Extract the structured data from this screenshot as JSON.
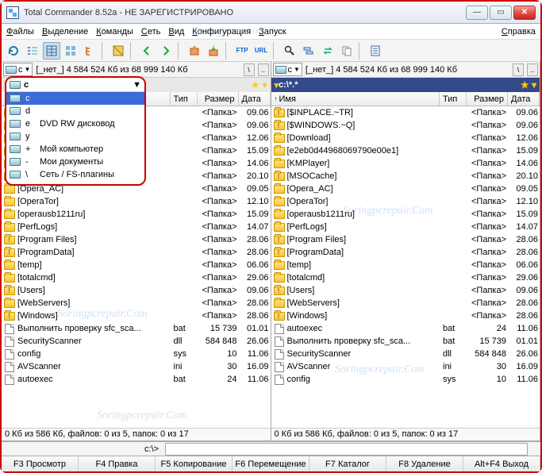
{
  "title": "Total Commander 8.52a - НЕ ЗАРЕГИСТРИРОВАНО",
  "menu": [
    "Файлы",
    "Выделение",
    "Команды",
    "Сеть",
    "Вид",
    "Конфигурация",
    "Запуск"
  ],
  "menu_right": "Справка",
  "drivebar_left": "[_нет_]  4 584 524 Кб из 68 999 140 Кб",
  "drivebar_right": "[_нет_]  4 584 524 Кб из 68 999 140 Кб",
  "drive_letter": "c",
  "path_left": "",
  "path_right": "c:\\*.*",
  "cols": {
    "name": "Имя",
    "ext": "Тип",
    "ext2": "Тип",
    "size": "Размер",
    "date": "Дата"
  },
  "status": "0 Кб из 586 Кб, файлов: 0 из 5, папок: 0 из 17",
  "cmdprompt": "c:\\>",
  "fkeys": [
    "F3 Просмотр",
    "F4 Правка",
    "F5 Копирование",
    "F6 Перемещение",
    "F7 Каталог",
    "F8 Удаление",
    "Alt+F4 Выход"
  ],
  "drive_options": [
    {
      "l": "c",
      "d": "",
      "sel": true,
      "ico": "hdd"
    },
    {
      "l": "d",
      "d": "",
      "ico": "hdd"
    },
    {
      "l": "e",
      "d": "DVD RW дисковод",
      "ico": "cd"
    },
    {
      "l": "y",
      "d": "",
      "ico": "hdd"
    },
    {
      "l": "+",
      "d": "Мой компьютер",
      "ico": "pc"
    },
    {
      "l": "-",
      "d": "Мои документы",
      "ico": "doc"
    },
    {
      "l": "\\",
      "d": "Сеть / FS-плагины",
      "ico": "net"
    }
  ],
  "left_files": [
    {
      "n": "",
      "t": "",
      "s": "<Папка>",
      "d": "09.06",
      "ico": "fld"
    },
    {
      "n": "",
      "t": "",
      "s": "<Папка>",
      "d": "09.06",
      "ico": "fld"
    },
    {
      "n": "",
      "t": "",
      "s": "<Папка>",
      "d": "12.06",
      "ico": "fld"
    },
    {
      "n": "",
      "t": "",
      "s": "<Папка>",
      "d": "15.09",
      "ico": "fld"
    },
    {
      "n": "",
      "t": "",
      "s": "<Папка>",
      "d": "14.06",
      "ico": "fld"
    },
    {
      "n": "",
      "t": "",
      "s": "<Папка>",
      "d": "20.10",
      "ico": "fld"
    },
    {
      "n": "[Opera_AC]",
      "t": "",
      "s": "<Папка>",
      "d": "09.05",
      "ico": "fld"
    },
    {
      "n": "[OperaTor]",
      "t": "",
      "s": "<Папка>",
      "d": "12.10",
      "ico": "fld"
    },
    {
      "n": "[operausb1211ru]",
      "t": "",
      "s": "<Папка>",
      "d": "15.09",
      "ico": "fld"
    },
    {
      "n": "[PerfLogs]",
      "t": "",
      "s": "<Папка>",
      "d": "14.07",
      "ico": "fld"
    },
    {
      "n": "[Program Files]",
      "t": "",
      "s": "<Папка>",
      "d": "28.06",
      "ico": "exc"
    },
    {
      "n": "[ProgramData]",
      "t": "",
      "s": "<Папка>",
      "d": "28.06",
      "ico": "exc"
    },
    {
      "n": "[temp]",
      "t": "",
      "s": "<Папка>",
      "d": "06.06",
      "ico": "fld"
    },
    {
      "n": "[totalcmd]",
      "t": "",
      "s": "<Папка>",
      "d": "29.06",
      "ico": "fld"
    },
    {
      "n": "[Users]",
      "t": "",
      "s": "<Папка>",
      "d": "09.06",
      "ico": "exc"
    },
    {
      "n": "[WebServers]",
      "t": "",
      "s": "<Папка>",
      "d": "28.06",
      "ico": "fld"
    },
    {
      "n": "[Windows]",
      "t": "",
      "s": "<Папка>",
      "d": "28.06",
      "ico": "exc"
    },
    {
      "n": "Выполнить проверку sfc_sca...",
      "t": "bat",
      "s": "15 739",
      "d": "01.01",
      "ico": "fil"
    },
    {
      "n": "SecurityScanner",
      "t": "dll",
      "s": "584 848",
      "d": "26.06",
      "ico": "fil"
    },
    {
      "n": "config",
      "t": "sys",
      "s": "10",
      "d": "11.06",
      "ico": "fil"
    },
    {
      "n": "AVScanner",
      "t": "ini",
      "s": "30",
      "d": "16.09",
      "ico": "fil"
    },
    {
      "n": "autoexec",
      "t": "bat",
      "s": "24",
      "d": "11.06",
      "ico": "fil"
    }
  ],
  "right_files": [
    {
      "n": "[$INPLACE.~TR]",
      "t": "",
      "s": "<Папка>",
      "d": "09.06",
      "ico": "exc"
    },
    {
      "n": "[$WINDOWS.~Q]",
      "t": "",
      "s": "<Папка>",
      "d": "09.06",
      "ico": "exc"
    },
    {
      "n": "[Download]",
      "t": "",
      "s": "<Папка>",
      "d": "12.06",
      "ico": "fld"
    },
    {
      "n": "[e2eb0d44968069790e00e1]",
      "t": "",
      "s": "<Папка>",
      "d": "15.09",
      "ico": "fld"
    },
    {
      "n": "[KMPlayer]",
      "t": "",
      "s": "<Папка>",
      "d": "14.06",
      "ico": "fld"
    },
    {
      "n": "[MSOCache]",
      "t": "",
      "s": "<Папка>",
      "d": "20.10",
      "ico": "exc"
    },
    {
      "n": "[Opera_AC]",
      "t": "",
      "s": "<Папка>",
      "d": "09.05",
      "ico": "fld"
    },
    {
      "n": "[OperaTor]",
      "t": "",
      "s": "<Папка>",
      "d": "12.10",
      "ico": "fld"
    },
    {
      "n": "[operausb1211ru]",
      "t": "",
      "s": "<Папка>",
      "d": "15.09",
      "ico": "fld"
    },
    {
      "n": "[PerfLogs]",
      "t": "",
      "s": "<Папка>",
      "d": "14.07",
      "ico": "fld"
    },
    {
      "n": "[Program Files]",
      "t": "",
      "s": "<Папка>",
      "d": "28.06",
      "ico": "exc"
    },
    {
      "n": "[ProgramData]",
      "t": "",
      "s": "<Папка>",
      "d": "28.06",
      "ico": "exc"
    },
    {
      "n": "[temp]",
      "t": "",
      "s": "<Папка>",
      "d": "06.06",
      "ico": "fld"
    },
    {
      "n": "[totalcmd]",
      "t": "",
      "s": "<Папка>",
      "d": "29.06",
      "ico": "fld"
    },
    {
      "n": "[Users]",
      "t": "",
      "s": "<Папка>",
      "d": "09.06",
      "ico": "exc"
    },
    {
      "n": "[WebServers]",
      "t": "",
      "s": "<Папка>",
      "d": "28.06",
      "ico": "fld"
    },
    {
      "n": "[Windows]",
      "t": "",
      "s": "<Папка>",
      "d": "28.06",
      "ico": "exc"
    },
    {
      "n": "autoexec",
      "t": "bat",
      "s": "24",
      "d": "11.06",
      "ico": "fil"
    },
    {
      "n": "Выполнить проверку sfc_sca...",
      "t": "bat",
      "s": "15 739",
      "d": "01.01",
      "ico": "fil"
    },
    {
      "n": "SecurityScanner",
      "t": "dll",
      "s": "584 848",
      "d": "26.06",
      "ico": "fil"
    },
    {
      "n": "AVScanner",
      "t": "ini",
      "s": "30",
      "d": "16.09",
      "ico": "fil"
    },
    {
      "n": "config",
      "t": "sys",
      "s": "10",
      "d": "11.06",
      "ico": "fil"
    }
  ],
  "watermark": "Soringpcrepair.Com"
}
